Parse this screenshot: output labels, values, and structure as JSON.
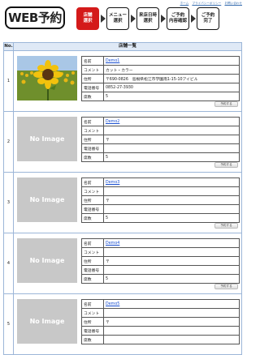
{
  "header": {
    "logo_text": "WEB予約",
    "top_links": [
      "ホーム",
      "プライバシーポリシー",
      "お問い合わせ"
    ],
    "steps": [
      {
        "line1": "店舗",
        "line2": "選択",
        "active": true
      },
      {
        "line1": "メニュー",
        "line2": "選択",
        "active": false
      },
      {
        "line1": "来店日時",
        "line2": "選択",
        "active": false
      },
      {
        "line1": "ご予約",
        "line2": "内容確認",
        "active": false
      },
      {
        "line1": "ご予約",
        "line2": "完了",
        "active": false
      }
    ]
  },
  "list": {
    "no_header": "No.",
    "title_header": "店舗一覧",
    "labels": {
      "name": "名前",
      "comment": "コメント",
      "address": "住所",
      "phone": "電話番号",
      "seats": "席数"
    },
    "select_label": "予約する",
    "no_image_text": "No Image",
    "stores": [
      {
        "no": "1",
        "name": "Demo1",
        "comment": "カット・カラー",
        "address": "〒690-0826　島根県松江市学園南1-15-10アイビル",
        "phone": "0852-27-3930",
        "seats": "5",
        "image": "sunflower"
      },
      {
        "no": "2",
        "name": "Demo2",
        "comment": "",
        "address": "〒",
        "phone": "",
        "seats": "5",
        "image": "none"
      },
      {
        "no": "3",
        "name": "Demo3",
        "comment": "",
        "address": "〒",
        "phone": "",
        "seats": "5",
        "image": "none"
      },
      {
        "no": "4",
        "name": "Demo4",
        "comment": "",
        "address": "〒",
        "phone": "",
        "seats": "5",
        "image": "none"
      },
      {
        "no": "5",
        "name": "Demo5",
        "comment": "",
        "address": "〒",
        "phone": "",
        "seats": "",
        "image": "none"
      }
    ]
  }
}
